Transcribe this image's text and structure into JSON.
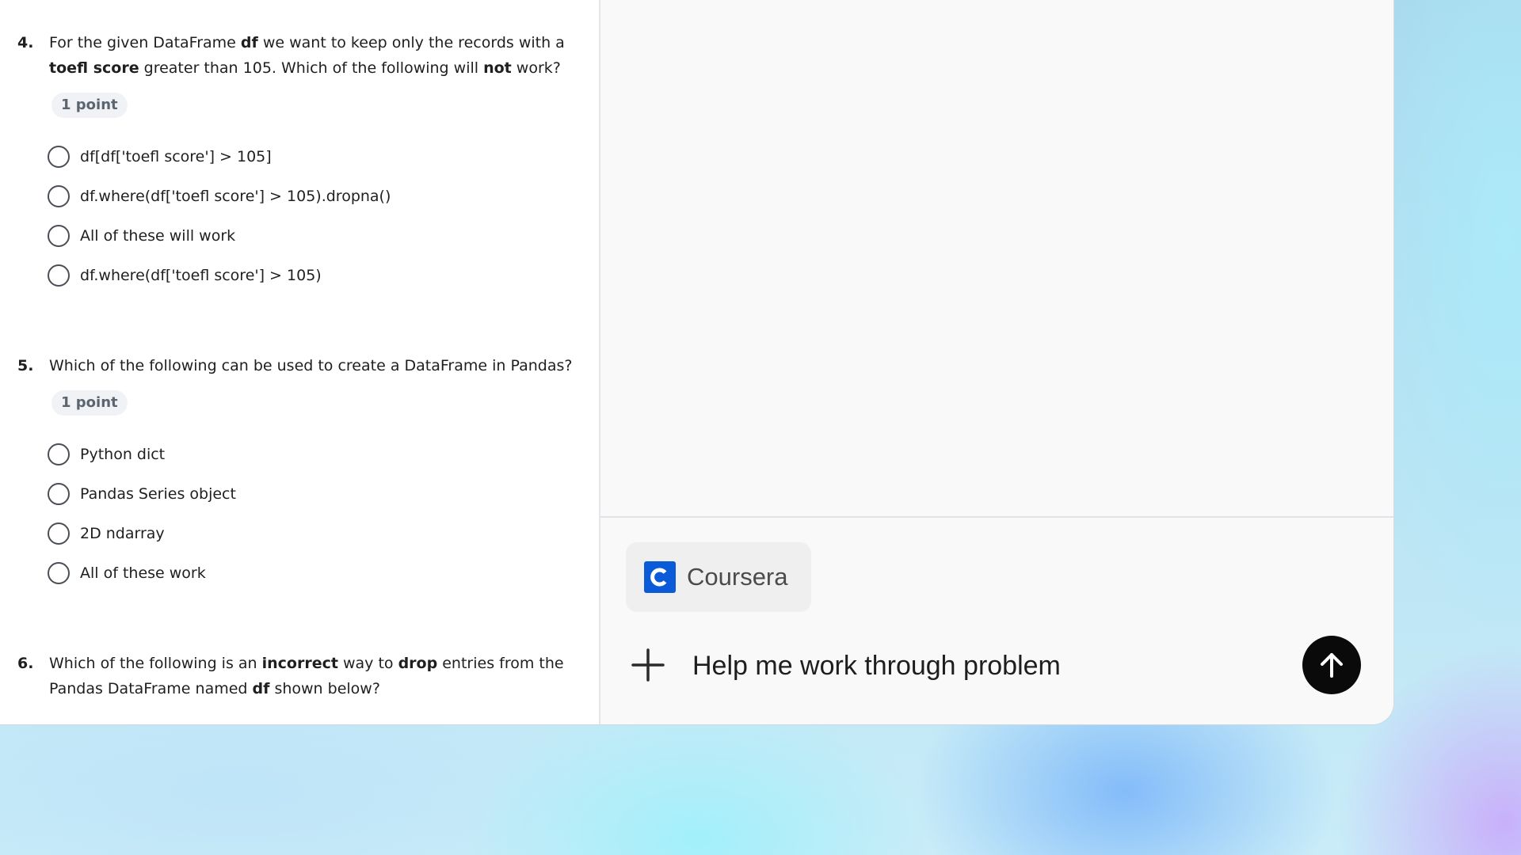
{
  "quiz": {
    "questions": [
      {
        "number": "4.",
        "text_html": "For the given DataFrame <b>df</b> we want to keep only the records with a <b>toefl score</b> greater than 105. Which of the following will <b>not</b> work?",
        "points": "1 point",
        "options": [
          "df[df['toefl score'] > 105]",
          "df.where(df['toefl score'] > 105).dropna()",
          "All of these will work",
          "df.where(df['toefl score'] > 105)"
        ]
      },
      {
        "number": "5.",
        "text_html": "Which of the following can be used to create a DataFrame in Pandas?",
        "points": "1 point",
        "options": [
          "Python dict",
          "Pandas Series object",
          "2D ndarray",
          "All of these work"
        ]
      },
      {
        "number": "6.",
        "text_html": "Which of the following is an <b>incorrect</b> way to <b>drop</b> entries from the Pandas DataFrame named <b>df</b> shown below?",
        "points": "",
        "options": []
      }
    ]
  },
  "chat": {
    "source_chip": {
      "name": "Coursera",
      "logo_letter": "C",
      "logo_color": "#0b5ad8"
    },
    "prompt_value": "Help me work through problem",
    "icons": {
      "add": "plus-icon",
      "send": "arrow-up-icon"
    }
  }
}
